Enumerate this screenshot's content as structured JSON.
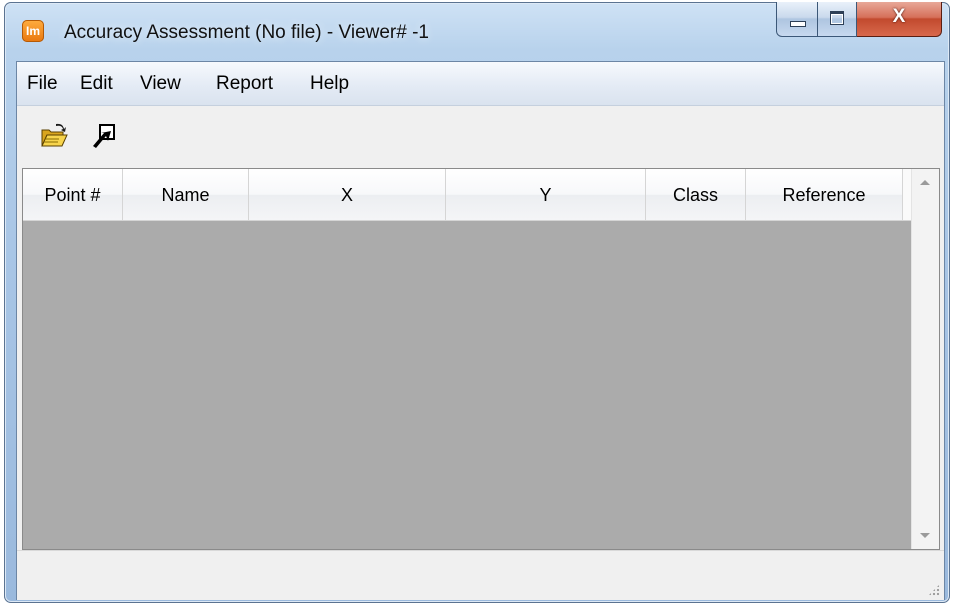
{
  "window": {
    "title": "Accuracy Assessment (No file) - Viewer# -1",
    "app_icon_label": "Im",
    "minimize_icon": "minimize-icon",
    "maximize_icon": "maximize-icon",
    "close_label": "X"
  },
  "menu": {
    "items": [
      {
        "label": "File"
      },
      {
        "label": "Edit"
      },
      {
        "label": "View"
      },
      {
        "label": "Report"
      },
      {
        "label": "Help"
      }
    ]
  },
  "toolbar": {
    "buttons": [
      {
        "icon": "open-folder-icon"
      },
      {
        "icon": "cursor-select-icon"
      }
    ]
  },
  "table": {
    "columns": [
      {
        "label": "Point #"
      },
      {
        "label": "Name"
      },
      {
        "label": "X"
      },
      {
        "label": "Y"
      },
      {
        "label": "Class"
      },
      {
        "label": "Reference"
      }
    ],
    "rows": []
  },
  "colors": {
    "grid_background": "#ababab",
    "title_bar": "#b8d2ec",
    "close_button": "#c24a2e"
  }
}
